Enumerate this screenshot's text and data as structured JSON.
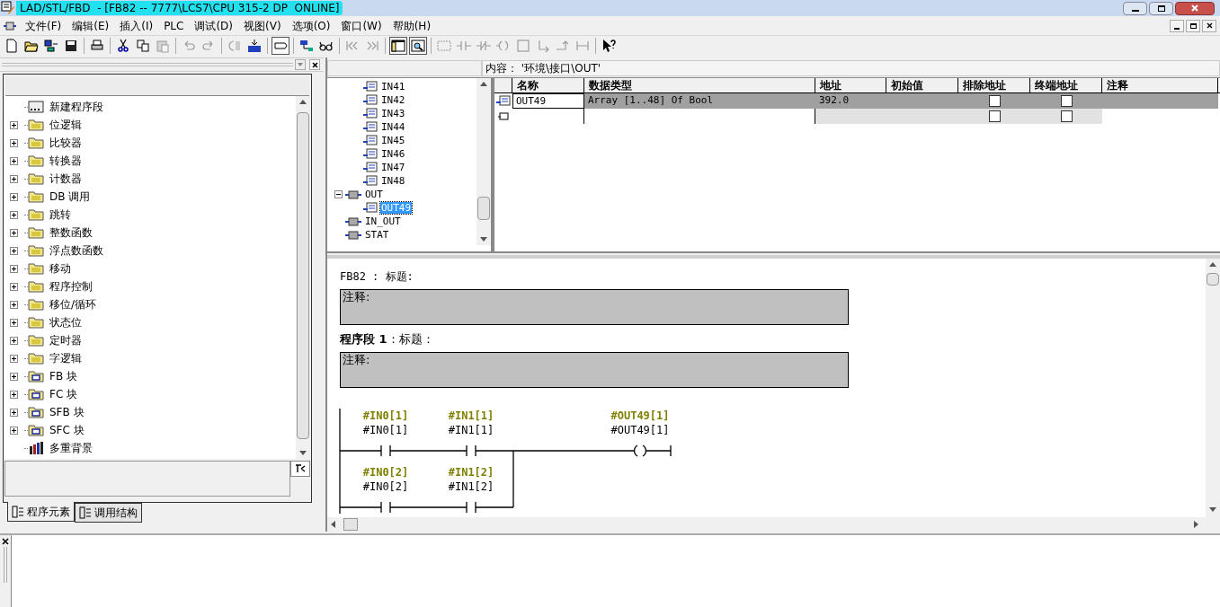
{
  "window": {
    "title": "LAD/STL/FBD  - [FB82 -- 7777\\LCS7\\CPU 315-2 DP  ONLINE]"
  },
  "menu": [
    "文件(F)",
    "编辑(E)",
    "插入(I)",
    "PLC",
    "调试(D)",
    "视图(V)",
    "选项(O)",
    "窗口(W)",
    "帮助(H)"
  ],
  "toolbar": [
    {
      "kind": "new",
      "disabled": false,
      "pressed": false
    },
    {
      "kind": "open",
      "disabled": false,
      "pressed": false
    },
    {
      "kind": "nodes",
      "disabled": false,
      "pressed": false
    },
    {
      "kind": "save",
      "disabled": false,
      "pressed": false
    },
    {
      "kind": "separator"
    },
    {
      "kind": "print",
      "disabled": false,
      "pressed": false
    },
    {
      "kind": "separator"
    },
    {
      "kind": "cut",
      "disabled": false,
      "pressed": false
    },
    {
      "kind": "copy",
      "disabled": false,
      "pressed": false
    },
    {
      "kind": "paste",
      "disabled": true,
      "pressed": false
    },
    {
      "kind": "separator"
    },
    {
      "kind": "undo",
      "disabled": true,
      "pressed": false
    },
    {
      "kind": "redo",
      "disabled": true,
      "pressed": false
    },
    {
      "kind": "separator"
    },
    {
      "kind": "compile",
      "disabled": true,
      "pressed": false
    },
    {
      "kind": "download",
      "disabled": false,
      "pressed": false
    },
    {
      "kind": "separator"
    },
    {
      "kind": "comment",
      "disabled": false,
      "pressed": true
    },
    {
      "kind": "separator"
    },
    {
      "kind": "network",
      "disabled": false,
      "pressed": false
    },
    {
      "kind": "monitor",
      "disabled": false,
      "pressed": false
    },
    {
      "kind": "separator"
    },
    {
      "kind": "first",
      "disabled": true,
      "pressed": false
    },
    {
      "kind": "last",
      "disabled": true,
      "pressed": false
    },
    {
      "kind": "separator"
    },
    {
      "kind": "overview",
      "disabled": false,
      "pressed": true
    },
    {
      "kind": "zoom",
      "disabled": false,
      "pressed": true
    },
    {
      "kind": "separator"
    },
    {
      "kind": "new-network",
      "disabled": true,
      "pressed": false
    },
    {
      "kind": "no-contact",
      "disabled": true,
      "pressed": false
    },
    {
      "kind": "nc-contact",
      "disabled": true,
      "pressed": false
    },
    {
      "kind": "coil",
      "disabled": true,
      "pressed": false
    },
    {
      "kind": "empty-box",
      "disabled": true,
      "pressed": false
    },
    {
      "kind": "open-branch",
      "disabled": true,
      "pressed": false
    },
    {
      "kind": "close-branch",
      "disabled": true,
      "pressed": false
    },
    {
      "kind": "connection",
      "disabled": true,
      "pressed": false
    },
    {
      "kind": "separator"
    },
    {
      "kind": "help",
      "disabled": false,
      "pressed": false
    }
  ],
  "elements_panel": {
    "items": [
      {
        "label": "新建程序段",
        "kind": "new-network",
        "selected": false
      },
      {
        "label": "位逻辑",
        "kind": "folder",
        "expanded": false,
        "selected": false
      },
      {
        "label": "比较器",
        "kind": "folder",
        "expanded": false,
        "selected": false
      },
      {
        "label": "转换器",
        "kind": "folder",
        "expanded": false,
        "selected": false
      },
      {
        "label": "计数器",
        "kind": "folder",
        "expanded": false,
        "selected": false
      },
      {
        "label": "DB 调用",
        "kind": "folder",
        "expanded": false,
        "selected": false
      },
      {
        "label": "跳转",
        "kind": "folder",
        "expanded": false,
        "selected": false
      },
      {
        "label": "整数函数",
        "kind": "folder",
        "expanded": false,
        "selected": false
      },
      {
        "label": "浮点数函数",
        "kind": "folder",
        "expanded": false,
        "selected": false
      },
      {
        "label": "移动",
        "kind": "folder",
        "expanded": false,
        "selected": false
      },
      {
        "label": "程序控制",
        "kind": "folder",
        "expanded": false,
        "selected": false
      },
      {
        "label": "移位/循环",
        "kind": "folder",
        "expanded": false,
        "selected": false
      },
      {
        "label": "状态位",
        "kind": "folder",
        "expanded": false,
        "selected": false
      },
      {
        "label": "定时器",
        "kind": "folder",
        "expanded": false,
        "selected": false
      },
      {
        "label": "字逻辑",
        "kind": "folder",
        "expanded": false,
        "selected": false
      },
      {
        "label": "FB 块",
        "kind": "block-folder",
        "expanded": false,
        "selected": false
      },
      {
        "label": "FC 块",
        "kind": "block-folder",
        "expanded": false,
        "selected": false
      },
      {
        "label": "SFB 块",
        "kind": "block-folder",
        "expanded": false,
        "selected": false
      },
      {
        "label": "SFC 块",
        "kind": "block-folder",
        "expanded": false,
        "selected": false
      },
      {
        "label": "多重背景",
        "kind": "multi-instance",
        "selected": false
      }
    ],
    "tabs": [
      {
        "label": "程序元素",
        "selected": true
      },
      {
        "label": "调用结构",
        "selected": false
      }
    ]
  },
  "interface": {
    "content": "内容： '环境\\接口\\OUT'",
    "tree": [
      {
        "label": "IN41",
        "kind": "param",
        "selected": false
      },
      {
        "label": "IN42",
        "kind": "param",
        "selected": false
      },
      {
        "label": "IN43",
        "kind": "param",
        "selected": false
      },
      {
        "label": "IN44",
        "kind": "param",
        "selected": false
      },
      {
        "label": "IN45",
        "kind": "param",
        "selected": false
      },
      {
        "label": "IN46",
        "kind": "param",
        "selected": false
      },
      {
        "label": "IN47",
        "kind": "param",
        "selected": false
      },
      {
        "label": "IN48",
        "kind": "param",
        "selected": false
      },
      {
        "label": "OUT",
        "kind": "section",
        "expanded": true,
        "selected": false,
        "children": [
          {
            "label": "OUT49",
            "kind": "param",
            "selected": true
          }
        ]
      },
      {
        "label": "IN_OUT",
        "kind": "section",
        "selected": false
      },
      {
        "label": "STAT",
        "kind": "section",
        "selected": false
      }
    ],
    "table": {
      "columns": [
        "名称",
        "数据类型",
        "地址",
        "初始值",
        "排除地址",
        "终端地址",
        "注释"
      ],
      "rows": [
        {
          "name": "OUT49",
          "data_type": "Array [1..48] Of Bool",
          "address": "392.0",
          "exclude_address": false,
          "terminal_address": false,
          "selected": true
        },
        {
          "exclude_address": false,
          "terminal_address": false,
          "selected": false
        }
      ]
    }
  },
  "editor": {
    "block_title": "FB82 : 标题:",
    "block_comment": "注释:",
    "network_title": "**程序段 1**：标题：",
    "network_comment": "注释:",
    "rungs": [
      {
        "contacts": [
          {
            "symbol": "#IN0[1]",
            "address": "#IN0[1]"
          },
          {
            "symbol": "#IN1[1]",
            "address": "#IN1[1]"
          }
        ],
        "coil": {
          "symbol": "#OUT49[1]",
          "address": "#OUT49[1]"
        }
      },
      {
        "contacts": [
          {
            "symbol": "#IN0[2]",
            "address": "#IN0[2]"
          },
          {
            "symbol": "#IN1[2]",
            "address": "#IN1[2]"
          }
        ]
      }
    ]
  }
}
